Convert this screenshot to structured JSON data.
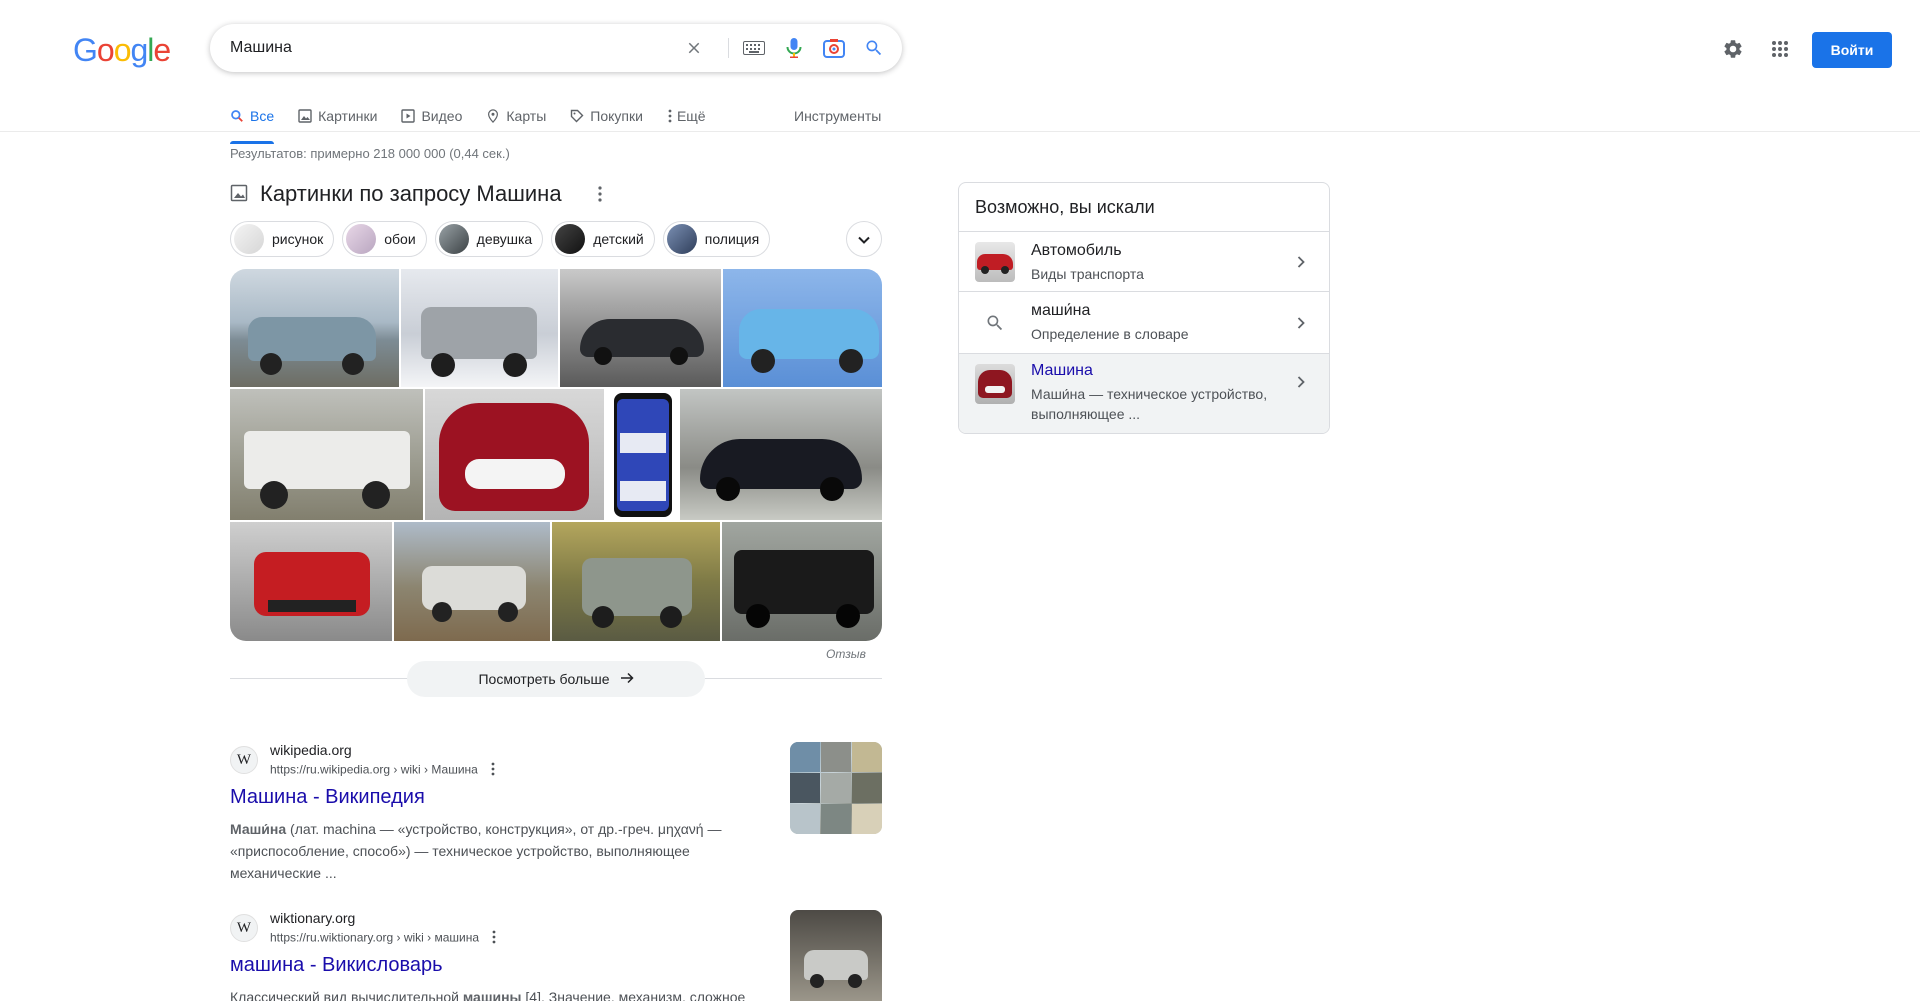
{
  "header": {
    "logo_letters": [
      "G",
      "o",
      "o",
      "g",
      "l",
      "e"
    ],
    "logo_colors": [
      "#4285f4",
      "#ea4335",
      "#fbbc05",
      "#4285f4",
      "#34a853",
      "#ea4335"
    ],
    "query": "Машина",
    "signin_label": "Войти"
  },
  "tabs": [
    {
      "label": "Все",
      "icon": "search-icon",
      "active": true
    },
    {
      "label": "Картинки",
      "icon": "image-icon"
    },
    {
      "label": "Видео",
      "icon": "play-icon"
    },
    {
      "label": "Карты",
      "icon": "map-pin-icon"
    },
    {
      "label": "Покупки",
      "icon": "tag-icon"
    },
    {
      "label": "Ещё",
      "icon": "more-vert-icon"
    }
  ],
  "tools_label": "Инструменты",
  "stats": "Результатов: примерно 218 000 000 (0,44 сек.)",
  "images_section": {
    "title": "Картинки по запросу Машина",
    "chips": [
      "рисунок",
      "обои",
      "девушка",
      "детский",
      "полиция"
    ],
    "feedback": "Отзыв",
    "more_label": "Посмотреть больше"
  },
  "results": [
    {
      "favicon_letter": "W",
      "site": "wikipedia.org",
      "crumb": "https://ru.wikipedia.org › wiki › Машина",
      "title": "Машина - Википедия",
      "snippet_bold": "Маши́на",
      "snippet_rest": " (лат. machina — «устройство, конструкция», от др.-греч. μηχανή — «приспособление, способ») — техническое устройство, выполняющее механические ..."
    },
    {
      "favicon_letter": "W",
      "site": "wiktionary.org",
      "crumb": "https://ru.wiktionary.org › wiki › машина",
      "title": "машина - Викисловарь",
      "snippet_pre": "Классический вид вычислительной ",
      "snippet_bold": "машины",
      "snippet_post": " [4]. Значение. механизм, сложное"
    }
  ],
  "right_panel": {
    "title": "Возможно, вы искали",
    "items": [
      {
        "name": "Автомобиль",
        "desc": "Виды транспорта"
      },
      {
        "name": "маши́на",
        "desc": "Определение в словаре"
      },
      {
        "name": "Машина",
        "desc": "Маши́на — техническое устройство, выполняющее ..."
      }
    ]
  },
  "colors": {
    "accent": "#1a73e8",
    "link": "#1a0dab"
  }
}
